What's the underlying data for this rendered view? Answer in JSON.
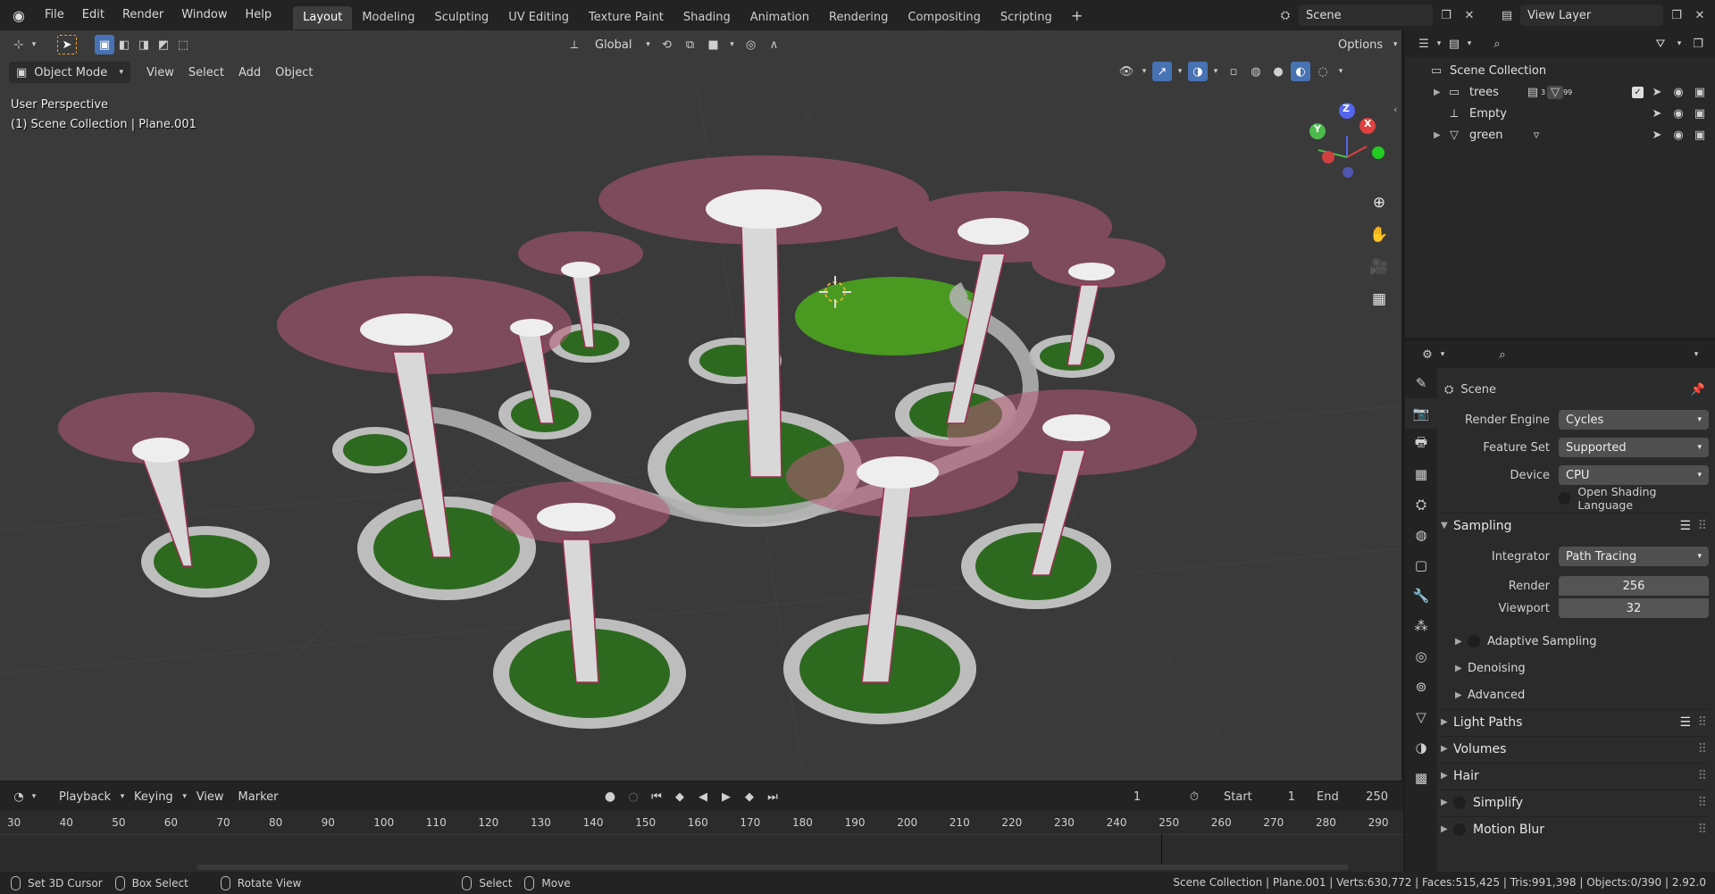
{
  "menu": [
    "File",
    "Edit",
    "Render",
    "Window",
    "Help"
  ],
  "workspaces": [
    "Layout",
    "Modeling",
    "Sculpting",
    "UV Editing",
    "Texture Paint",
    "Shading",
    "Animation",
    "Rendering",
    "Compositing",
    "Scripting"
  ],
  "active_workspace": "Layout",
  "scene_name": "Scene",
  "view_layer": "View Layer",
  "viewport": {
    "transform_orientation": "Global",
    "options_label": "Options",
    "mode": "Object Mode",
    "header_menus": [
      "View",
      "Select",
      "Add",
      "Object"
    ],
    "perspective_label": "User Perspective",
    "collection_label": "(1) Scene Collection | Plane.001",
    "gizmo": {
      "x": "X",
      "y": "Y",
      "z": "Z"
    }
  },
  "outliner": {
    "root": "Scene Collection",
    "items": [
      {
        "name": "trees",
        "badge": "99",
        "extra": "3"
      },
      {
        "name": "Empty"
      },
      {
        "name": "green"
      }
    ]
  },
  "properties": {
    "context": "Scene",
    "render_engine": {
      "label": "Render Engine",
      "value": "Cycles"
    },
    "feature_set": {
      "label": "Feature Set",
      "value": "Supported"
    },
    "device": {
      "label": "Device",
      "value": "CPU"
    },
    "osl": "Open Shading Language",
    "sampling": {
      "title": "Sampling",
      "integrator_label": "Integrator",
      "integrator": "Path Tracing",
      "render_label": "Render",
      "render": "256",
      "viewport_label": "Viewport",
      "viewport": "32",
      "subpanels": [
        "Adaptive Sampling",
        "Denoising",
        "Advanced"
      ]
    },
    "sections": [
      "Light Paths",
      "Volumes",
      "Hair",
      "Simplify",
      "Motion Blur"
    ]
  },
  "timeline": {
    "menus": [
      "Playback",
      "Keying",
      "View",
      "Marker"
    ],
    "current_frame": "1",
    "start_label": "Start",
    "start": "1",
    "end_label": "End",
    "end": "250",
    "ticks": [
      "30",
      "40",
      "50",
      "60",
      "70",
      "80",
      "90",
      "100",
      "110",
      "120",
      "130",
      "140",
      "150",
      "160",
      "170",
      "180",
      "190",
      "200",
      "210",
      "220",
      "230",
      "240",
      "250",
      "260",
      "270",
      "280",
      "290"
    ]
  },
  "status": {
    "set_cursor": "Set 3D Cursor",
    "box_select": "Box Select",
    "rotate_view": "Rotate View",
    "select": "Select",
    "move": "Move",
    "stats": "Scene Collection | Plane.001 | Verts:630,772 | Faces:515,425 | Tris:991,398 | Objects:0/390 | 2.92.0"
  }
}
